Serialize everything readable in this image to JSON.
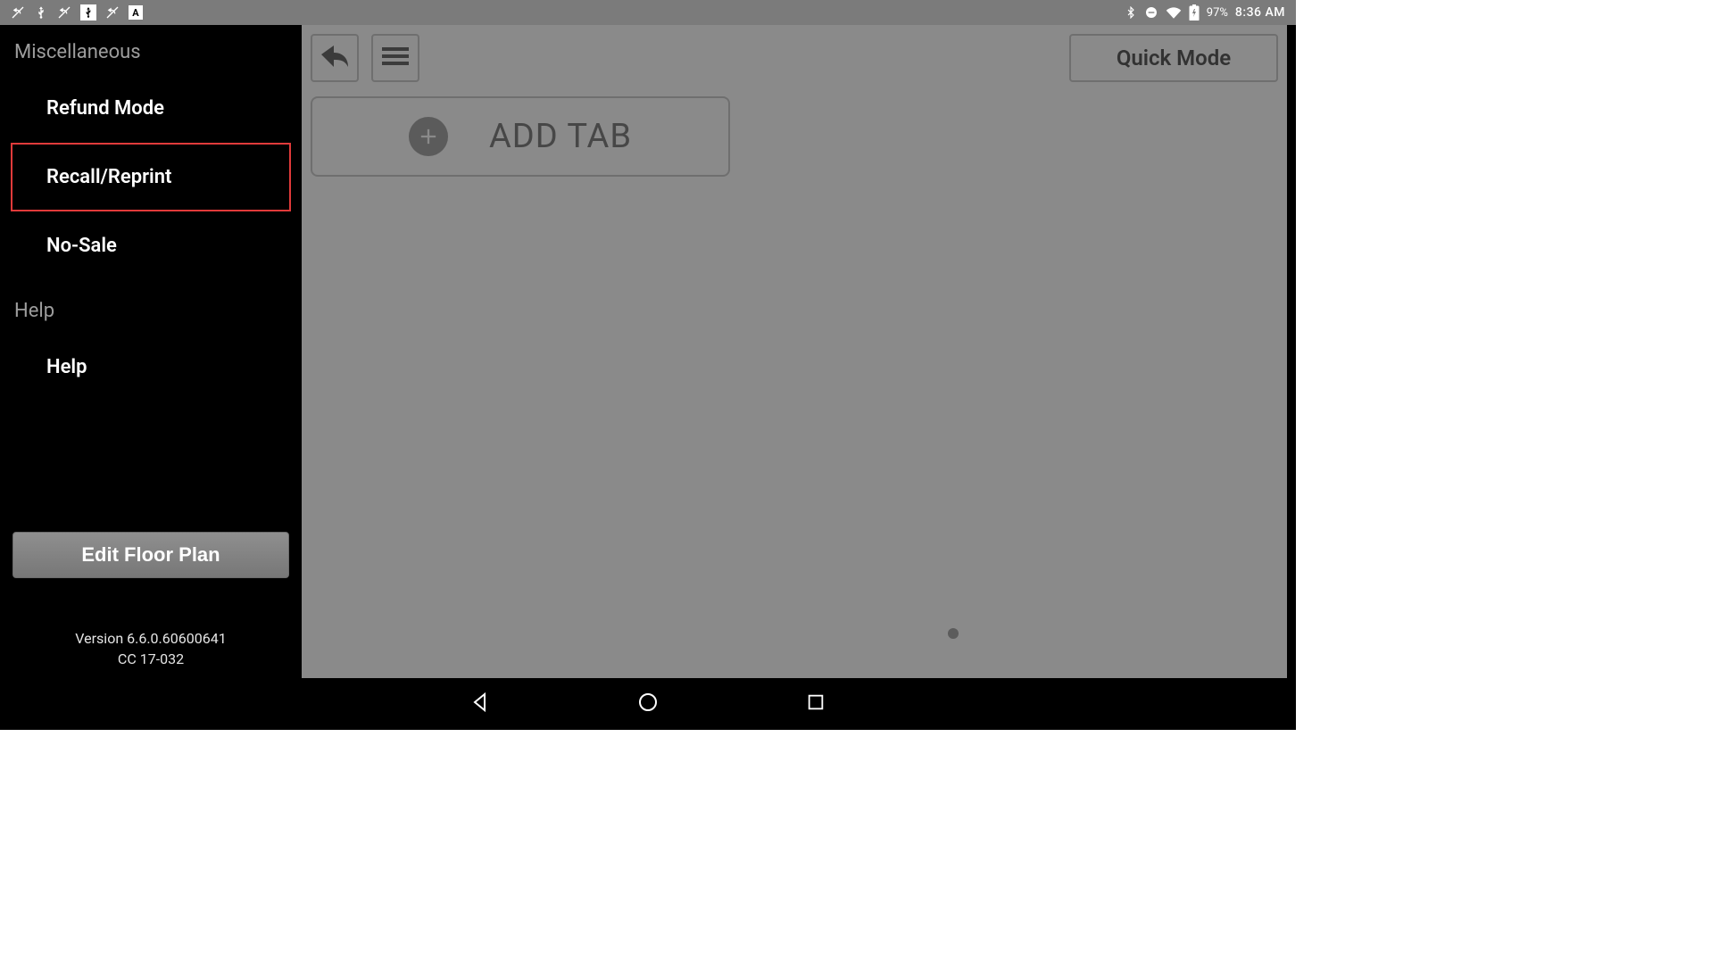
{
  "status_bar": {
    "battery_percent": "97%",
    "time": "8:36 AM"
  },
  "sidebar": {
    "section_misc": "Miscellaneous",
    "items": [
      {
        "label": "Refund Mode",
        "highlight": false
      },
      {
        "label": "Recall/Reprint",
        "highlight": true
      },
      {
        "label": "No-Sale",
        "highlight": false
      }
    ],
    "section_help": "Help",
    "help_item": "Help",
    "edit_floor_plan": "Edit Floor Plan",
    "version_line1": "Version 6.6.0.60600641",
    "version_line2": "CC 17-032"
  },
  "main": {
    "quick_mode": "Quick Mode",
    "add_tab": "ADD TAB"
  }
}
